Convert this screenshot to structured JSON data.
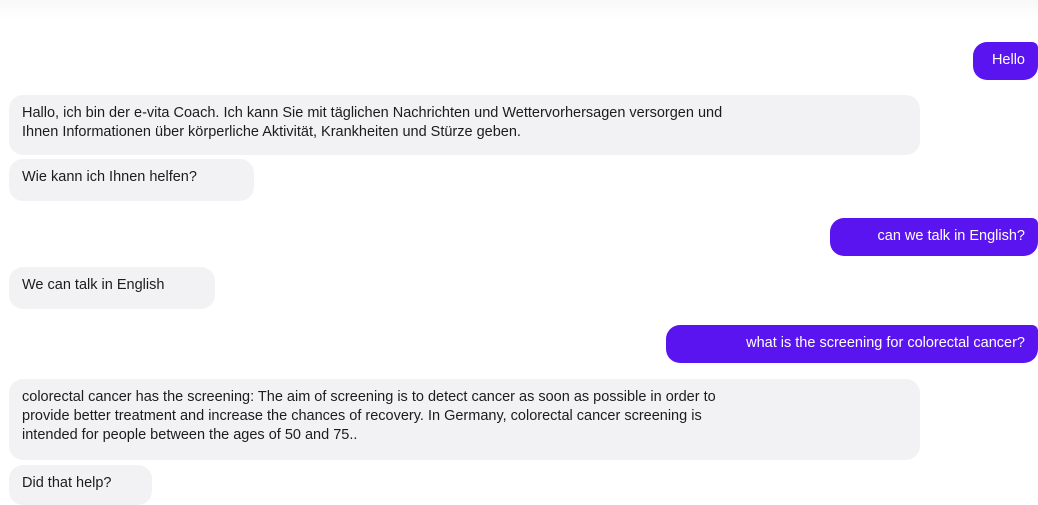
{
  "messages": {
    "u1": "Hello",
    "b1": {
      "line1": "Hallo, ich bin der e-vita Coach. Ich kann Sie mit täglichen Nachrichten und Wettervorhersagen versorgen und",
      "line2": "Ihnen Informationen über körperliche Aktivität, Krankheiten und Stürze geben."
    },
    "b2": "Wie kann ich Ihnen helfen?",
    "u2": "can we talk in English?",
    "b3": "We can talk in English",
    "u3": "what is the screening for colorectal cancer?",
    "b4": {
      "line1": "colorectal cancer has the screening: The aim of screening is to detect cancer as soon as possible in order to",
      "line2": "provide better treatment and increase the chances of recovery. In Germany, colorectal cancer screening is",
      "line3": "intended for people between the ages of 50 and 75.."
    },
    "b5": "Did that help?"
  },
  "colors": {
    "user_bubble": "#5a14f0",
    "bot_bubble": "#f2f2f4",
    "bot_text": "#1c1c1c",
    "user_text": "#ffffff"
  }
}
